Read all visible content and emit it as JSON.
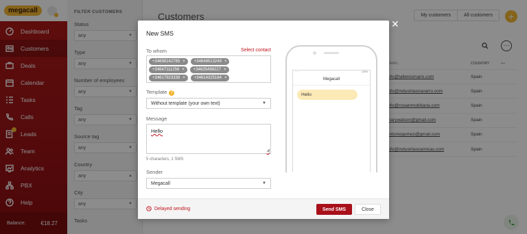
{
  "sidebar": {
    "logo": "megacall",
    "items": [
      {
        "label": "Dashboard",
        "icon": "dashboard-icon"
      },
      {
        "label": "Customers",
        "icon": "customers-icon"
      },
      {
        "label": "Deals",
        "icon": "deals-icon"
      },
      {
        "label": "Calendar",
        "icon": "calendar-icon"
      },
      {
        "label": "Tasks",
        "icon": "tasks-icon"
      },
      {
        "label": "Calls",
        "icon": "calls-icon"
      },
      {
        "label": "Leads",
        "icon": "leads-icon"
      },
      {
        "label": "Team",
        "icon": "team-icon"
      },
      {
        "label": "Analytics",
        "icon": "analytics-icon"
      },
      {
        "label": "PBX",
        "icon": "pbx-icon"
      },
      {
        "label": "Help",
        "icon": "help-icon"
      }
    ],
    "active": "Customers",
    "balance_label": "Balance:",
    "balance_value": "€18.27"
  },
  "filters": {
    "heading": "FILTER CUSTOMERS",
    "groups": [
      {
        "label": "Status",
        "value": "any"
      },
      {
        "label": "Type",
        "value": "any"
      },
      {
        "label": "Number of employees",
        "value": "any"
      },
      {
        "label": "Tag",
        "value": "any"
      },
      {
        "label": "Source tag",
        "value": "any"
      },
      {
        "label": "Country",
        "value": "any"
      },
      {
        "label": "City",
        "value": "any"
      },
      {
        "label": "Tasks",
        "value": ""
      }
    ]
  },
  "main": {
    "title": "Customers",
    "segments": [
      "My customers",
      "All customers"
    ],
    "add": "+",
    "columns": [
      "EMAIL",
      "COUNTRY",
      "•••"
    ],
    "rows": [
      {
        "email": "info@talleresmario.com",
        "country": "Spain"
      },
      {
        "email": "info@industriasnavarro.com",
        "country": "Spain"
      },
      {
        "email": "info@rosainmobiliaria.com",
        "country": "Spain"
      },
      {
        "email": "marywatson@gmail.com",
        "country": "Spain"
      },
      {
        "email": "antoniogomez@gmail.com",
        "country": "Spain"
      },
      {
        "email": "info@industriascarnicas.com",
        "country": "Spain"
      }
    ]
  },
  "modal": {
    "title": "New SMS",
    "to_label": "To whom",
    "select_contact": "Select contact",
    "recipients": [
      "+34698142785",
      "+34648513249",
      "+34647111256",
      "+34635498227",
      "+34617923338",
      "+34614325164"
    ],
    "template_label": "Template",
    "template_help": "?",
    "template_value": "Without template (your own text)",
    "message_label": "Message",
    "message_value": "Hello",
    "counter": "5 characters, 1 SMS",
    "sender_label": "Sender",
    "sender_value": "Megacall",
    "delayed": "Delayed sending",
    "send": "Send SMS",
    "close": "Close",
    "close_x": "✕"
  },
  "phone": {
    "status_left": "",
    "status_right": "100%",
    "title": "Megacall",
    "bubble": "Hello"
  },
  "colors": {
    "brand_red": "#a8101a",
    "accent": "#f2b632"
  }
}
